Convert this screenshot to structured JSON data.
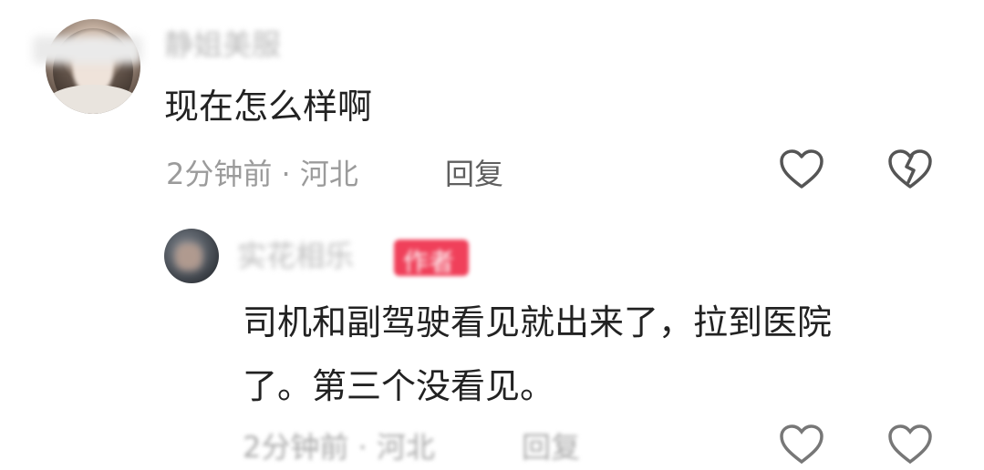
{
  "comments": {
    "main": {
      "username": "静姐美服",
      "text": "现在怎么样啊",
      "meta": "2分钟前 · 河北",
      "reply_label": "回复"
    },
    "reply": {
      "username": "实花相乐",
      "badge": "作者",
      "text_line1": "司机和副驾驶看见就出来了，拉到医院",
      "text_line2": "了。第三个没看见。",
      "meta": "2分钟前 · 河北",
      "reply_label": "回复"
    }
  },
  "icons": {
    "like": "heart-outline-icon",
    "dislike": "broken-heart-icon"
  },
  "colors": {
    "text": "#222222",
    "meta": "#9b9b9b",
    "icon": "#555555",
    "badge": "#f0405a"
  }
}
